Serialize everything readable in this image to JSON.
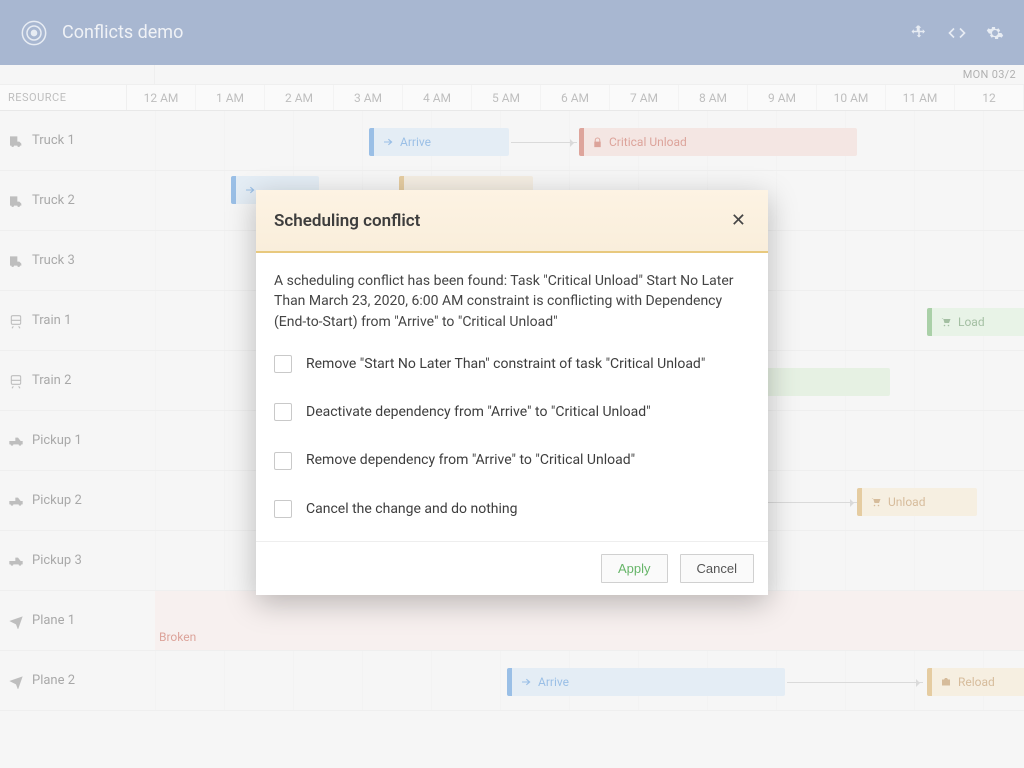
{
  "header": {
    "title": "Conflicts demo"
  },
  "date_label": "MON 03/2",
  "resource_header": "RESOURCE",
  "hours": [
    "12 AM",
    "1 AM",
    "2 AM",
    "3 AM",
    "4 AM",
    "5 AM",
    "6 AM",
    "7 AM",
    "8 AM",
    "9 AM",
    "10 AM",
    "11 AM",
    "12"
  ],
  "resources": [
    {
      "name": "Truck 1",
      "icon": "truck"
    },
    {
      "name": "Truck 2",
      "icon": "truck"
    },
    {
      "name": "Truck 3",
      "icon": "truck"
    },
    {
      "name": "Train 1",
      "icon": "train"
    },
    {
      "name": "Train 2",
      "icon": "train"
    },
    {
      "name": "Pickup 1",
      "icon": "pickup"
    },
    {
      "name": "Pickup 2",
      "icon": "pickup"
    },
    {
      "name": "Pickup 3",
      "icon": "pickup"
    },
    {
      "name": "Plane 1",
      "icon": "plane"
    },
    {
      "name": "Plane 2",
      "icon": "plane"
    }
  ],
  "events": {
    "arrive1": "Arrive",
    "critical": "Critical Unload",
    "train1_load": "Load",
    "p2_unload": "Unload",
    "broken": "Broken",
    "plane2_arrive": "Arrive",
    "plane2_reload": "Reload"
  },
  "modal": {
    "title": "Scheduling conflict",
    "description": "A scheduling conflict has been found: Task \"Critical Unload\" Start No Later Than March 23, 2020, 6:00 AM constraint is conflicting with Dependency (End-to-Start) from \"Arrive\" to \"Critical Unload\"",
    "options": [
      "Remove \"Start No Later Than\" constraint of task \"Critical Unload\"",
      "Deactivate dependency from \"Arrive\" to \"Critical Unload\"",
      "Remove dependency from \"Arrive\" to \"Critical Unload\"",
      "Cancel the change and do nothing"
    ],
    "buttons": {
      "apply": "Apply",
      "cancel": "Cancel"
    }
  }
}
